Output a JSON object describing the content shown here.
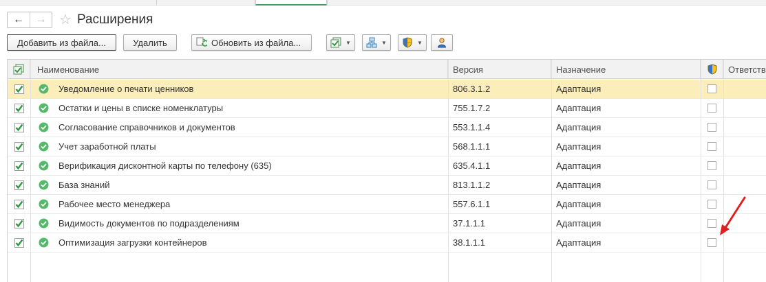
{
  "window": {
    "title": "Расширения"
  },
  "toolbar": {
    "add_from_file": "Добавить из файла...",
    "delete": "Удалить",
    "update_from_file": "Обновить из файла..."
  },
  "table": {
    "columns": {
      "name": "Наименование",
      "version": "Версия",
      "purpose": "Назначение",
      "responsible": "Ответств"
    },
    "rows": [
      {
        "name": "Уведомление о печати ценников",
        "version": "806.3.1.2",
        "purpose": "Адаптация",
        "active": true,
        "safe_mode": false,
        "selected": true
      },
      {
        "name": "Остатки и цены в списке номенклатуры",
        "version": "755.1.7.2",
        "purpose": "Адаптация",
        "active": true,
        "safe_mode": false,
        "selected": false
      },
      {
        "name": "Согласование справочников и документов",
        "version": "553.1.1.4",
        "purpose": "Адаптация",
        "active": true,
        "safe_mode": false,
        "selected": false
      },
      {
        "name": "Учет заработной платы",
        "version": "568.1.1.1",
        "purpose": "Адаптация",
        "active": true,
        "safe_mode": false,
        "selected": false
      },
      {
        "name": "Верификация дисконтной карты по телефону (635)",
        "version": "635.4.1.1",
        "purpose": "Адаптация",
        "active": true,
        "safe_mode": false,
        "selected": false
      },
      {
        "name": "База знаний",
        "version": "813.1.1.2",
        "purpose": "Адаптация",
        "active": true,
        "safe_mode": false,
        "selected": false
      },
      {
        "name": "Рабочее место менеджера",
        "version": "557.6.1.1",
        "purpose": "Адаптация",
        "active": true,
        "safe_mode": false,
        "selected": false
      },
      {
        "name": "Видимость документов по подразделениям",
        "version": "37.1.1.1",
        "purpose": "Адаптация",
        "active": true,
        "safe_mode": false,
        "selected": false
      },
      {
        "name": "Оптимизация загрузки контейнеров",
        "version": "38.1.1.1",
        "purpose": "Адаптация",
        "active": true,
        "safe_mode": false,
        "selected": false
      }
    ]
  },
  "colors": {
    "selected_row": "#fbeebb",
    "check_green": "#2e9a3e",
    "status_green": "#55b96a",
    "annotation_arrow": "#e02020",
    "tab_accent": "#3f9b58"
  },
  "icons": {
    "back": "arrow-left-icon",
    "forward": "arrow-right-icon",
    "favorite": "star-icon",
    "status": "check-circle-icon",
    "safe_mode": "shield-icon"
  }
}
